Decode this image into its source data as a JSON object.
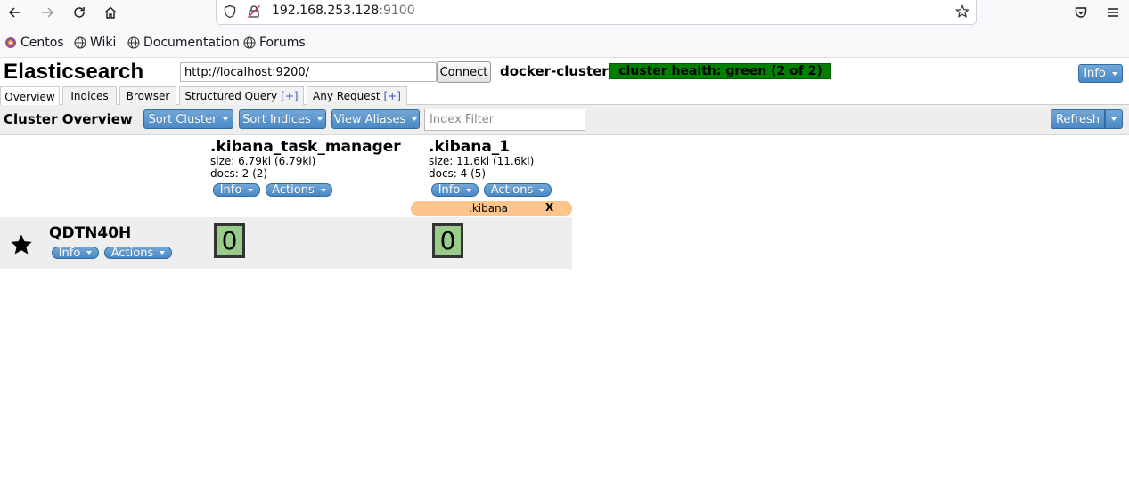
{
  "browser": {
    "url_host": "192.168.253.128",
    "url_port": ":9100",
    "bookmarks": [
      "Centos",
      "Wiki",
      "Documentation",
      "Forums"
    ]
  },
  "header": {
    "title": "Elasticsearch",
    "connect_url": "http://localhost:9200/",
    "connect_label": "Connect",
    "cluster_name": "docker-cluster",
    "cluster_health": "cluster health: green (2 of 2)",
    "info_label": "Info",
    "health_color": "#008000"
  },
  "tabs": [
    {
      "label": "Overview"
    },
    {
      "label": "Indices"
    },
    {
      "label": "Browser"
    },
    {
      "label": "Structured Query",
      "plus": "[+]"
    },
    {
      "label": "Any Request",
      "plus": "[+]"
    }
  ],
  "toolbar": {
    "title": "Cluster Overview",
    "sort_cluster": "Sort Cluster",
    "sort_indices": "Sort Indices",
    "view_aliases": "View Aliases",
    "index_filter_placeholder": "Index Filter",
    "refresh": "Refresh"
  },
  "indices": [
    {
      "name": ".kibana_task_manager",
      "size": "size: 6.79ki (6.79ki)",
      "docs": "docs: 2 (2)",
      "info": "Info",
      "actions": "Actions"
    },
    {
      "name": ".kibana_1",
      "size": "size: 11.6ki (11.6ki)",
      "docs": "docs: 4 (5)",
      "info": "Info",
      "actions": "Actions"
    }
  ],
  "alias": {
    "name": ".kibana",
    "remove": "X",
    "color": "#fcc58c"
  },
  "node": {
    "name": "QDTN40H",
    "info": "Info",
    "actions": "Actions",
    "shards": [
      "0",
      "0"
    ],
    "shard_color": "#99cc88"
  }
}
